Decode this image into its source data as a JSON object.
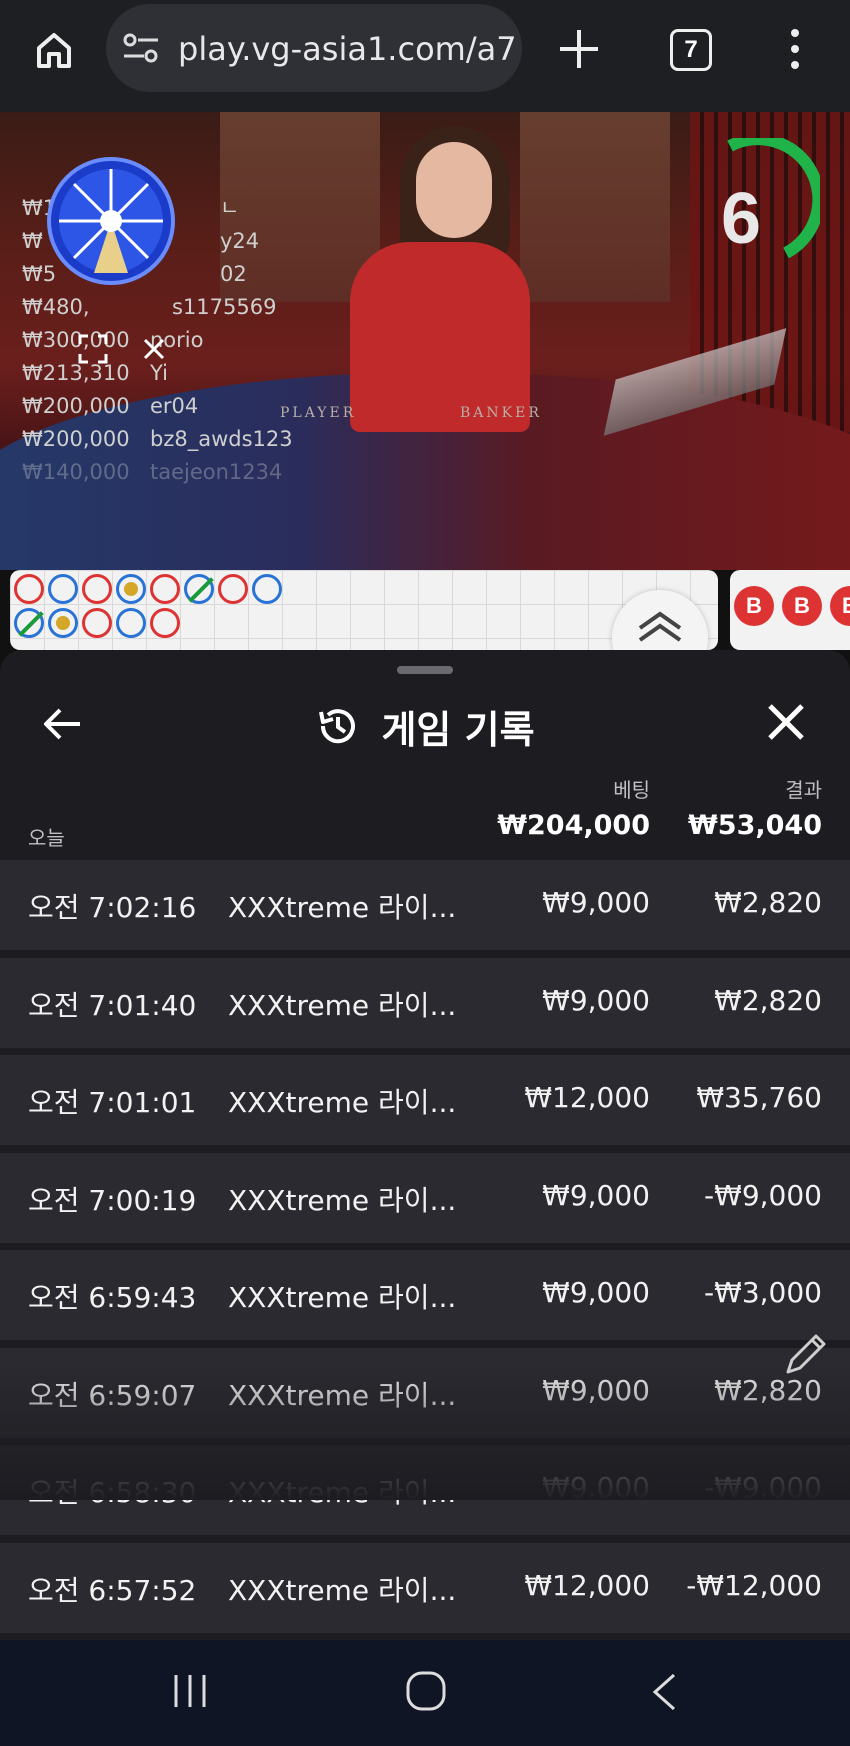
{
  "browser": {
    "url": "play.vg-asia1.com/a7",
    "tab_count": "7"
  },
  "live": {
    "timer": "6",
    "table_labels": {
      "player": "PLAYER",
      "banker": "BANKER"
    },
    "bets": [
      {
        "amount": "₩1",
        "user": "ㄴ"
      },
      {
        "amount": "₩",
        "user": "y24"
      },
      {
        "amount": "₩5",
        "user": "02"
      },
      {
        "amount": "₩480,",
        "user": "s1175569"
      },
      {
        "amount": "₩300,000",
        "user": "norio"
      },
      {
        "amount": "₩213,310",
        "user": "Yi"
      },
      {
        "amount": "₩200,000",
        "user": "er04"
      },
      {
        "amount": "₩200,000",
        "user": "bz8_awds123"
      },
      {
        "amount": "₩140,000",
        "user": "taejeon1234"
      }
    ],
    "road_right": [
      "B",
      "B",
      "B"
    ]
  },
  "history": {
    "title": "게임 기록",
    "summary": {
      "today_label": "오늘",
      "bet_label": "베팅",
      "result_label": "결과",
      "bet_total": "₩204,000",
      "result_total": "₩53,040"
    },
    "rows": [
      {
        "time": "오전 7:02:16",
        "game": "XXXtreme 라이...",
        "bet": "₩9,000",
        "result": "₩2,820"
      },
      {
        "time": "오전 7:01:40",
        "game": "XXXtreme 라이...",
        "bet": "₩9,000",
        "result": "₩2,820"
      },
      {
        "time": "오전 7:01:01",
        "game": "XXXtreme 라이...",
        "bet": "₩12,000",
        "result": "₩35,760"
      },
      {
        "time": "오전 7:00:19",
        "game": "XXXtreme 라이...",
        "bet": "₩9,000",
        "result": "-₩9,000"
      },
      {
        "time": "오전 6:59:43",
        "game": "XXXtreme 라이...",
        "bet": "₩9,000",
        "result": "-₩3,000"
      },
      {
        "time": "오전 6:59:07",
        "game": "XXXtreme 라이...",
        "bet": "₩9,000",
        "result": "₩2,820"
      },
      {
        "time": "오전 6:58:30",
        "game": "XXXtreme 라이...",
        "bet": "₩9,000",
        "result": "-₩9,000"
      },
      {
        "time": "오전 6:57:52",
        "game": "XXXtreme 라이...",
        "bet": "₩12,000",
        "result": "-₩12,000"
      }
    ]
  },
  "colors": {
    "sheet_bg": "#1d1c21",
    "row_bg": "#2b2a30",
    "timer_green": "#1fb34a",
    "player_blue": "#2a73d6",
    "banker_red": "#d33333"
  },
  "icons": [
    "home-icon",
    "site-settings-icon",
    "plus-icon",
    "more-icon",
    "wheel-icon",
    "expand-icon",
    "close-icon",
    "chevron-up-icon",
    "back-arrow-icon",
    "history-icon",
    "pencil-icon",
    "nav-recents-icon",
    "nav-home-icon",
    "nav-back-icon"
  ]
}
